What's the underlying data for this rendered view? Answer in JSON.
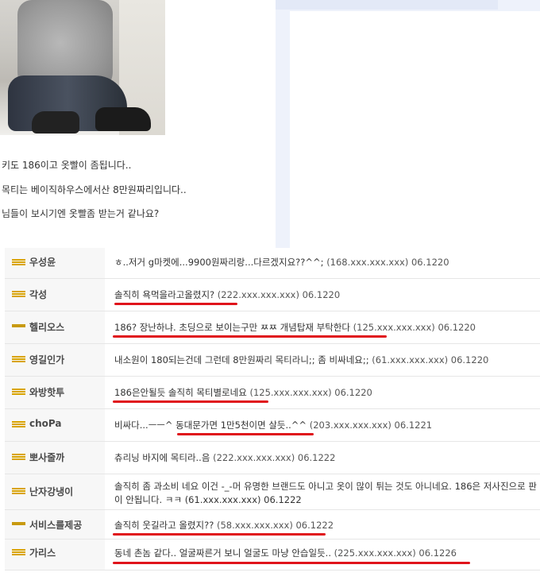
{
  "post": {
    "lines": [
      "키도 186이고 옷빨이 좀됩니다..",
      "목티는 베이직하우스에서산 8만원짜리입니다..",
      "님들이 보시기엔 옷빨좀 받는거 같나요?"
    ]
  },
  "comments": [
    {
      "nick": "우성윤",
      "text": "ㅎ..저거 g마켓에...9900원짜리랑...다르겠지요??^^;",
      "ip": "(168.xxx.xxx.xxx)",
      "date": "06.1220"
    },
    {
      "nick": "각성",
      "text": "솔직히 욕먹을라고올렸지?",
      "ip": "(222.xxx.xxx.xxx)",
      "date": "06.1220"
    },
    {
      "nick": "헬리오스",
      "text": "186? 장난하냐. 초딩으로 보이는구만 ㅉㅉ 개념탑재 부탁한다",
      "ip": "(125.xxx.xxx.xxx)",
      "date": "06.1220"
    },
    {
      "nick": "영길인가",
      "text": "내소원이 180되는건데 그런데 8만원짜리 목티라니;; 좀 비싸네요;;",
      "ip": "(61.xxx.xxx.xxx)",
      "date": "06.1220"
    },
    {
      "nick": "와방핫투",
      "text": "186은안될듯 솔직히 목티별로네요",
      "ip": "(125.xxx.xxx.xxx)",
      "date": "06.1220"
    },
    {
      "nick": "choPa",
      "text": "비싸다...ㅡㅡ^ 동대문가면 1만5천이면 살듯..^^",
      "ip": "(203.xxx.xxx.xxx)",
      "date": "06.1221"
    },
    {
      "nick": "뽀사줄까",
      "text": "츄리닝 바지에 목티라..음",
      "ip": "(222.xxx.xxx.xxx)",
      "date": "06.1222"
    },
    {
      "nick": "난자강냉이",
      "text": "솔직히 좀 과소비 네요 이건 -_-머 유명한 브랜드도 아니고 옷이 많이 튀는 것도 아니네요. 186은 저사진으로 판",
      "text2": "이 안됩니다. ㅋㅋ",
      "ip": "(61.xxx.xxx.xxx)",
      "date": "06.1222"
    },
    {
      "nick": "서비스를제공",
      "text": "솔직히 웃길라고 올렸지??",
      "ip": "(58.xxx.xxx.xxx)",
      "date": "06.1222"
    },
    {
      "nick": "가리스",
      "text": "동네 촌놈 같다.. 얼굴짜른거 보니 얼굴도 마냥 안습일듯..",
      "ip": "(225.xxx.xxx.xxx)",
      "date": "06.1226"
    }
  ],
  "colors": {
    "underline": "#e0141b",
    "icon": "#d9a400",
    "nick_bg": "#f7f7f7",
    "panel": "#eef2fb"
  },
  "icons": [
    "member-level-icon"
  ]
}
